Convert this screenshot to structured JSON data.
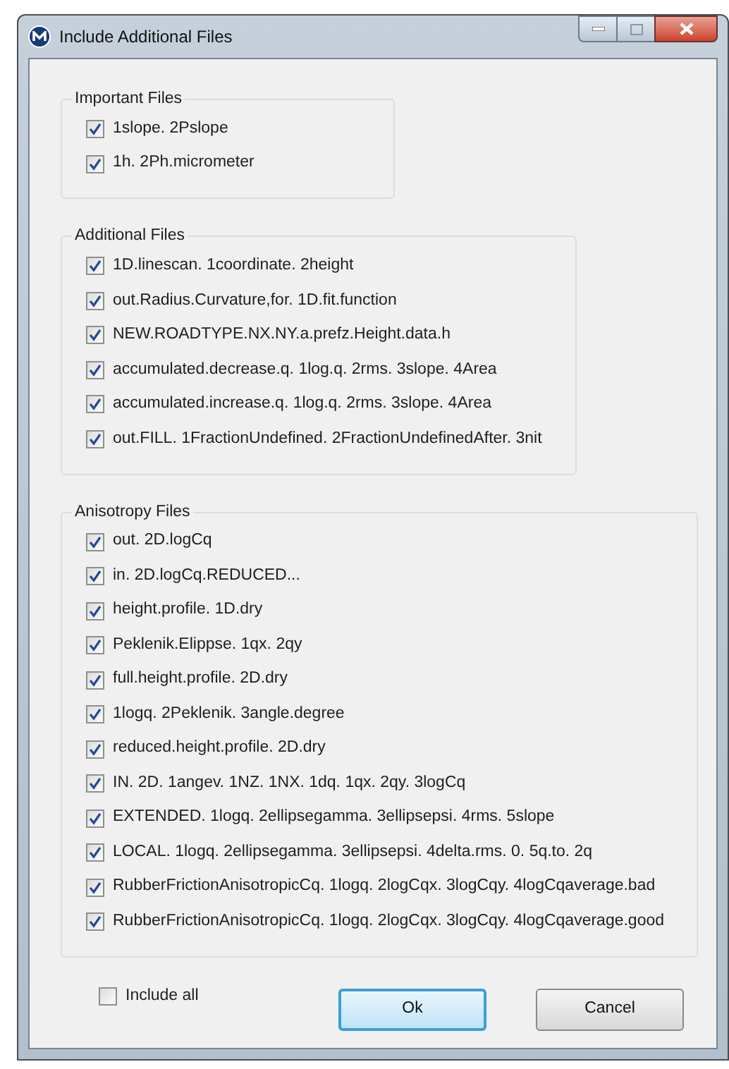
{
  "window": {
    "title": "Include Additional Files"
  },
  "groups": [
    {
      "title": "Important Files",
      "items": [
        {
          "label": "1slope. 2Pslope",
          "checked": true
        },
        {
          "label": "1h. 2Ph.micrometer",
          "checked": true
        }
      ]
    },
    {
      "title": "Additional Files",
      "items": [
        {
          "label": "1D.linescan. 1coordinate. 2height",
          "checked": true
        },
        {
          "label": "out.Radius.Curvature,for. 1D.fit.function",
          "checked": true
        },
        {
          "label": "NEW.ROADTYPE.NX.NY.a.prefz.Height.data.h",
          "checked": true
        },
        {
          "label": "accumulated.decrease.q. 1log.q. 2rms. 3slope. 4Area",
          "checked": true
        },
        {
          "label": "accumulated.increase.q. 1log.q. 2rms. 3slope. 4Area",
          "checked": true
        },
        {
          "label": "out.FILL. 1FractionUndefined. 2FractionUndefinedAfter. 3nit",
          "checked": true
        }
      ]
    },
    {
      "title": "Anisotropy Files",
      "items": [
        {
          "label": "out. 2D.logCq",
          "checked": true
        },
        {
          "label": "in. 2D.logCq.REDUCED...",
          "checked": true
        },
        {
          "label": "height.profile. 1D.dry",
          "checked": true
        },
        {
          "label": "Peklenik.Elippse. 1qx. 2qy",
          "checked": true
        },
        {
          "label": "full.height.profile. 2D.dry",
          "checked": true
        },
        {
          "label": "1logq. 2Peklenik. 3angle.degree",
          "checked": true
        },
        {
          "label": "reduced.height.profile. 2D.dry",
          "checked": true
        },
        {
          "label": "IN. 2D. 1angev. 1NZ. 1NX. 1dq. 1qx. 2qy. 3logCq",
          "checked": true
        },
        {
          "label": "EXTENDED. 1logq. 2ellipsegamma. 3ellipsepsi. 4rms. 5slope",
          "checked": true
        },
        {
          "label": "LOCAL. 1logq. 2ellipsegamma. 3ellipsepsi. 4delta.rms. 0. 5q.to. 2q",
          "checked": true
        },
        {
          "label": "RubberFrictionAnisotropicCq. 1logq. 2logCqx. 3logCqy. 4logCqaverage.bad",
          "checked": true
        },
        {
          "label": "RubberFrictionAnisotropicCq. 1logq. 2logCqx. 3logCqy. 4logCqaverage.good",
          "checked": true
        }
      ]
    }
  ],
  "include_all": {
    "label": "Include all",
    "checked": false
  },
  "buttons": [
    {
      "label": "Ok",
      "kind": "default"
    },
    {
      "label": "Cancel",
      "kind": "normal"
    }
  ]
}
